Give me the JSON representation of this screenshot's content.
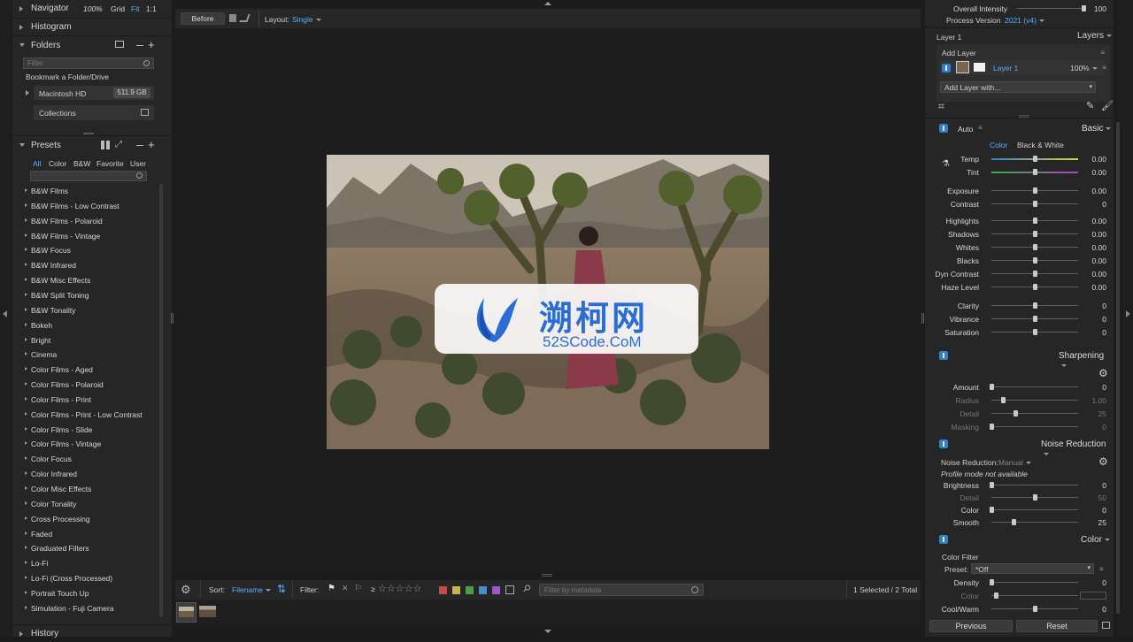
{
  "left": {
    "navigator": {
      "title": "Navigator",
      "zoom_options": [
        "100%",
        "Grid",
        "Fit",
        "1:1"
      ],
      "active_zoom": "Fit"
    },
    "histogram": {
      "title": "Histogram"
    },
    "folders": {
      "title": "Folders",
      "filter_placeholder": "Filter",
      "bookmark": "Bookmark a Folder/Drive",
      "drive": "Macintosh HD",
      "drive_size": "511.9 GB",
      "collections": "Collections"
    },
    "presets": {
      "title": "Presets",
      "tabs": [
        "All",
        "Color",
        "B&W",
        "Favorite",
        "User"
      ],
      "active_tab": "All",
      "items": [
        "B&W Films",
        "B&W Films - Low Contrast",
        "B&W Films - Polaroid",
        "B&W Films - Vintage",
        "B&W Focus",
        "B&W Infrared",
        "B&W Misc Effects",
        "B&W Split Toning",
        "B&W Tonality",
        "Bokeh",
        "Bright",
        "Cinema",
        "Color Films - Aged",
        "Color Films - Polaroid",
        "Color Films - Print",
        "Color Films - Print - Low Contrast",
        "Color Films - Slide",
        "Color Films - Vintage",
        "Color Focus",
        "Color Infrared",
        "Color Misc Effects",
        "Color Tonality",
        "Cross Processing",
        "Faded",
        "Graduated Filters",
        "Lo-Fi",
        "Lo-Fi (Cross Processed)",
        "Portrait Touch Up",
        "Simulation - Fuji Camera"
      ]
    },
    "history": {
      "title": "History"
    }
  },
  "toolbar": {
    "before_label": "Before",
    "layout_label": "Layout:",
    "layout_value": "Single"
  },
  "watermark": {
    "main": "溯柯网",
    "sub": "52SCode.CoM"
  },
  "bottombar": {
    "sort_label": "Sort:",
    "sort_value": "Filename",
    "filter_label": "Filter:",
    "rating_prefix": "≥",
    "stars": [
      "☆",
      "☆",
      "☆",
      "☆",
      "☆"
    ],
    "color_labels": [
      "#c94a4a",
      "#c2b84a",
      "#4aa14a",
      "#4a8ec9",
      "#9a5ac9"
    ],
    "metadata_placeholder": "Filter by metadata",
    "selection": "1 Selected / 2 Total"
  },
  "right": {
    "overall_intensity": {
      "label": "Overall Intensity",
      "value": "100",
      "level": 100
    },
    "process_version": {
      "label": "Process Version",
      "value": "2021 (v4)"
    },
    "layers": {
      "layer_title": "Layer 1",
      "panel_title": "Layers",
      "add_layer": "Add Layer",
      "layer_name": "Layer 1",
      "layer_opacity": "100%",
      "add_layer_with": "Add Layer with..."
    },
    "basic": {
      "auto": "Auto",
      "title": "Basic",
      "tab_color": "Color",
      "tab_bw": "Black & White",
      "sliders": [
        {
          "label": "Temp",
          "value": "0.00",
          "level": 0.5
        },
        {
          "label": "Tint",
          "value": "0.00",
          "level": 0.5
        },
        {
          "label": "Exposure",
          "value": "0.00",
          "level": 0.5
        },
        {
          "label": "Contrast",
          "value": "0",
          "level": 0.5
        },
        {
          "label": "Highlights",
          "value": "0.00",
          "level": 0.5
        },
        {
          "label": "Shadows",
          "value": "0.00",
          "level": 0.5
        },
        {
          "label": "Whites",
          "value": "0.00",
          "level": 0.5
        },
        {
          "label": "Blacks",
          "value": "0.00",
          "level": 0.5
        },
        {
          "label": "Dyn Contrast",
          "value": "0.00",
          "level": 0.5
        },
        {
          "label": "Haze Level",
          "value": "0.00",
          "level": 0.5
        },
        {
          "label": "Clarity",
          "value": "0",
          "level": 0.5
        },
        {
          "label": "Vibrance",
          "value": "0",
          "level": 0.5
        },
        {
          "label": "Saturation",
          "value": "0",
          "level": 0.5
        }
      ]
    },
    "sharpening": {
      "title": "Sharpening",
      "sliders": [
        {
          "label": "Amount",
          "value": "0",
          "level": 0
        },
        {
          "label": "Radius",
          "value": "1.00",
          "level": 0.13
        },
        {
          "label": "Detail",
          "value": "25",
          "level": 0.28
        },
        {
          "label": "Masking",
          "value": "0",
          "level": 0
        }
      ]
    },
    "noise": {
      "title": "Noise Reduction",
      "nr_label": "Noise Reduction:",
      "nr_value": "Manual",
      "note": "Profile mode not available",
      "sliders": [
        {
          "label": "Brightness",
          "value": "0",
          "level": 0
        },
        {
          "label": "Detail",
          "value": "50",
          "level": 0.5
        },
        {
          "label": "Color",
          "value": "0",
          "level": 0
        },
        {
          "label": "Smooth",
          "value": "25",
          "level": 0.25
        }
      ]
    },
    "color": {
      "title": "Color",
      "filter_title": "Color Filter",
      "preset_label": "Preset:",
      "preset_value": "*Off",
      "sliders": [
        {
          "label": "Density",
          "value": "0",
          "level": 0
        },
        {
          "label": "Color",
          "value": "",
          "level": 0.05
        },
        {
          "label": "Cool/Warm",
          "value": "0",
          "level": 0.5
        }
      ]
    },
    "previous": "Previous",
    "reset": "Reset"
  }
}
